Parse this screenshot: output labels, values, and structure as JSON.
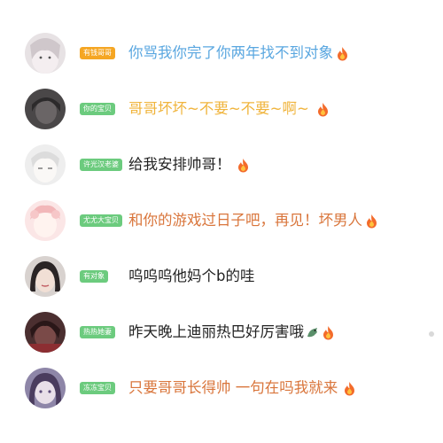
{
  "colors": {
    "badge_orange": "#f5a623",
    "badge_green": "#6ccb7e",
    "badge_teal": "#5ec9b0",
    "text_blue": "#5aa7e0",
    "text_yellow": "#f0b43c",
    "text_black": "#222222",
    "text_orange": "#d9753b",
    "flame": "#f36b2b"
  },
  "comments": [
    {
      "badge": "有钱哥哥",
      "text": "你骂我你完了你两年找不到对象",
      "emoji": "fire-icon"
    },
    {
      "badge": "你的宝贝",
      "text": "哥哥坏坏~不要~不要~啊~",
      "emoji": "fire-icon"
    },
    {
      "badge": "许光汉老婆",
      "text": "给我安排帅哥！",
      "emoji": "fire-icon"
    },
    {
      "badge": "尤尤大宝贝",
      "text": "和你的游戏过日子吧，再见！坏男人",
      "emoji": "fire-icon"
    },
    {
      "badge": "有对象",
      "text": "呜呜呜他妈个b的哇",
      "emoji": ""
    },
    {
      "badge": "热热她妻",
      "text": "昨天晚上迪丽热巴好厉害哦",
      "emoji": "fire-icon"
    },
    {
      "badge": "冻冻宝贝",
      "text": "只要哥哥长得帅 一句在吗我就来",
      "emoji": "fire-icon"
    }
  ]
}
